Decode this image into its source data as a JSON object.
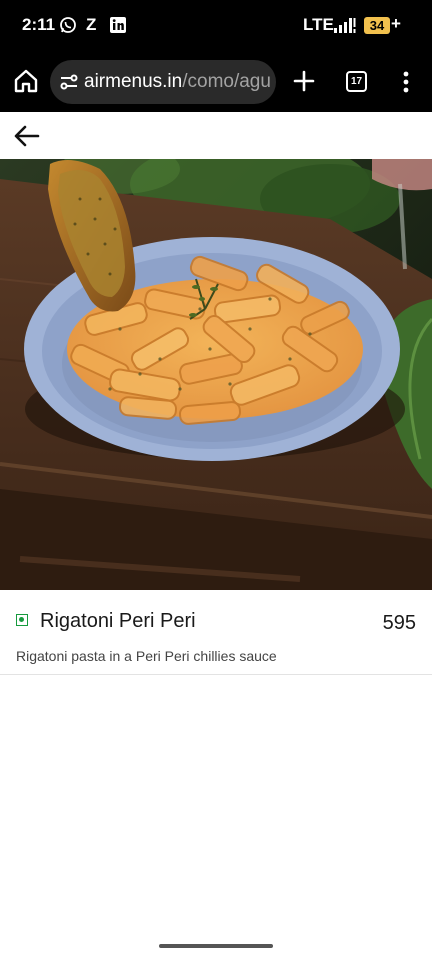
{
  "status_bar": {
    "time": "2:11",
    "network": "LTE",
    "battery": "34",
    "battery_charging": "+",
    "battery_color": "#f2c14e",
    "notification_icons": [
      "whatsapp-icon",
      "z-icon",
      "linkedin-icon"
    ],
    "z_label": "Z"
  },
  "browser": {
    "url_domain": "airmenus.in",
    "url_path": "/como/agu",
    "tab_count": "17"
  },
  "item": {
    "name": "Rigatoni Peri Peri",
    "price": "595",
    "description": "Rigatoni pasta in a Peri Peri chillies sauce",
    "diet_indicator": "veg",
    "veg_color": "#169a3e"
  }
}
